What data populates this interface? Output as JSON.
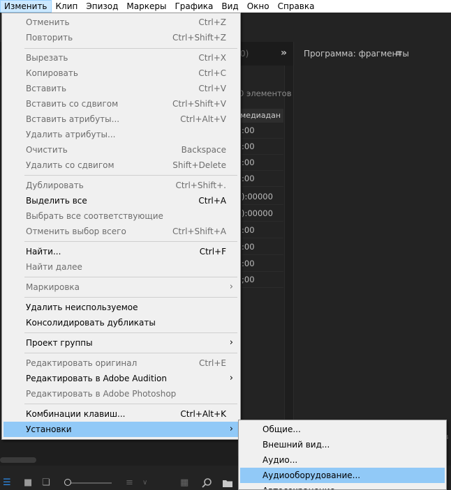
{
  "menubar": {
    "items": [
      "Изменить",
      "Клип",
      "Эпизод",
      "Маркеры",
      "Графика",
      "Вид",
      "Окно",
      "Справка"
    ]
  },
  "background": {
    "program_title": "Программа: фрагменты",
    "elements_count": "0 элементов",
    "column_header": "медиадан",
    "rows": [
      ":00",
      ":00",
      ":00",
      ":00",
      "):00000",
      "):00000",
      ":00",
      ":00",
      ":00",
      ";00"
    ],
    "paren": "0)",
    "chevron": "»",
    "hamburger": "≡",
    "right_edge": "в"
  },
  "edit_menu": {
    "undo": {
      "label": "Отменить",
      "shortcut": "Ctrl+Z"
    },
    "redo": {
      "label": "Повторить",
      "shortcut": "Ctrl+Shift+Z"
    },
    "cut": {
      "label": "Вырезать",
      "shortcut": "Ctrl+X"
    },
    "copy": {
      "label": "Копировать",
      "shortcut": "Ctrl+C"
    },
    "paste": {
      "label": "Вставить",
      "shortcut": "Ctrl+V"
    },
    "paste_insert": {
      "label": "Вставить со сдвигом",
      "shortcut": "Ctrl+Shift+V"
    },
    "paste_attributes": {
      "label": "Вставить атрибуты...",
      "shortcut": "Ctrl+Alt+V"
    },
    "remove_attributes": {
      "label": "Удалить атрибуты..."
    },
    "clear": {
      "label": "Очистить",
      "shortcut": "Backspace"
    },
    "ripple_delete": {
      "label": "Удалить со сдвигом",
      "shortcut": "Shift+Delete"
    },
    "duplicate": {
      "label": "Дублировать",
      "shortcut": "Ctrl+Shift+."
    },
    "select_all": {
      "label": "Выделить все",
      "shortcut": "Ctrl+A"
    },
    "select_all_matching": {
      "label": "Выбрать все соответствующие"
    },
    "deselect_all": {
      "label": "Отменить выбор всего",
      "shortcut": "Ctrl+Shift+A"
    },
    "find": {
      "label": "Найти...",
      "shortcut": "Ctrl+F"
    },
    "find_next": {
      "label": "Найти далее"
    },
    "label": {
      "label": "Маркировка"
    },
    "remove_unused": {
      "label": "Удалить неиспользуемое"
    },
    "consolidate_duplicates": {
      "label": "Консолидировать дубликаты"
    },
    "team_project": {
      "label": "Проект группы"
    },
    "edit_original": {
      "label": "Редактировать оригинал",
      "shortcut": "Ctrl+E"
    },
    "edit_in_audition": {
      "label": "Редактировать в Adobe Audition"
    },
    "edit_in_photoshop": {
      "label": "Редактировать в Adobe Photoshop"
    },
    "keyboard_shortcuts": {
      "label": "Комбинации клавиш...",
      "shortcut": "Ctrl+Alt+K"
    },
    "preferences": {
      "label": "Установки"
    },
    "submenu_arrow": "›"
  },
  "preferences_submenu": {
    "items": [
      "Общие...",
      "Внешний вид...",
      "Аудио...",
      "Аудиооборудование...",
      "Автосохранение..."
    ]
  }
}
